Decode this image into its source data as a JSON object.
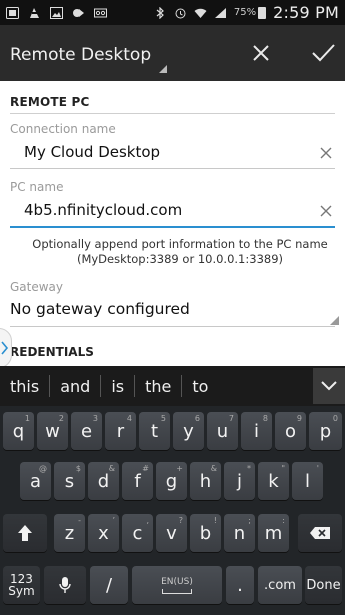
{
  "status_bar": {
    "battery": "75%",
    "time": "2:59 PM"
  },
  "action_bar": {
    "title": "Remote Desktop"
  },
  "form": {
    "section_remote_pc": "REMOTE PC",
    "connection_name": {
      "label": "Connection name",
      "value": "My Cloud Desktop"
    },
    "pc_name": {
      "label": "PC name",
      "value": "4b5.nfinitycloud.com"
    },
    "hint": "Optionally append port information to the PC name (MyDesktop:3389 or 10.0.0.1:3389)",
    "gateway": {
      "label": "Gateway",
      "value": "No gateway configured"
    },
    "section_credentials": "REDENTIALS"
  },
  "suggestions": [
    "this",
    "and",
    "is",
    "the",
    "to"
  ],
  "keyboard": {
    "row1": [
      {
        "key": "q",
        "sub": "1"
      },
      {
        "key": "w",
        "sub": "2"
      },
      {
        "key": "e",
        "sub": "3"
      },
      {
        "key": "r",
        "sub": "4"
      },
      {
        "key": "t",
        "sub": "5"
      },
      {
        "key": "y",
        "sub": "6"
      },
      {
        "key": "u",
        "sub": "7"
      },
      {
        "key": "i",
        "sub": "8"
      },
      {
        "key": "o",
        "sub": "9"
      },
      {
        "key": "p",
        "sub": "0"
      }
    ],
    "row2": [
      {
        "key": "a",
        "sub": "@"
      },
      {
        "key": "s",
        "sub": "$"
      },
      {
        "key": "d",
        "sub": "&"
      },
      {
        "key": "f",
        "sub": "#"
      },
      {
        "key": "g",
        "sub": "+"
      },
      {
        "key": "h",
        "sub": "&"
      },
      {
        "key": "j",
        "sub": "*"
      },
      {
        "key": "k",
        "sub": "\""
      },
      {
        "key": "l",
        "sub": "'"
      }
    ],
    "row3": [
      {
        "key": "z",
        "sub": "-"
      },
      {
        "key": "x",
        "sub": "’"
      },
      {
        "key": "c",
        "sub": ","
      },
      {
        "key": "v",
        "sub": "?"
      },
      {
        "key": "b",
        "sub": "!"
      },
      {
        "key": "n",
        "sub": ";"
      },
      {
        "key": "m",
        "sub": ":"
      }
    ],
    "row4": {
      "sym": "123\nSym",
      "slash": "/",
      "space": "EN(US)",
      "dot": ".",
      "com": ".com",
      "done": "Done"
    }
  },
  "colors": {
    "accent": "#2a8fd0",
    "action_bar": "#2b2b2b",
    "keyboard_bg": "#222528"
  },
  "icons": {
    "status_left": [
      "gallery-icon",
      "bug-icon",
      "image-icon",
      "game-icon",
      "voicemail-icon"
    ],
    "status_right": [
      "bluetooth-icon",
      "alarm-icon",
      "wifi-icon",
      "signal-icon",
      "battery-icon"
    ]
  }
}
